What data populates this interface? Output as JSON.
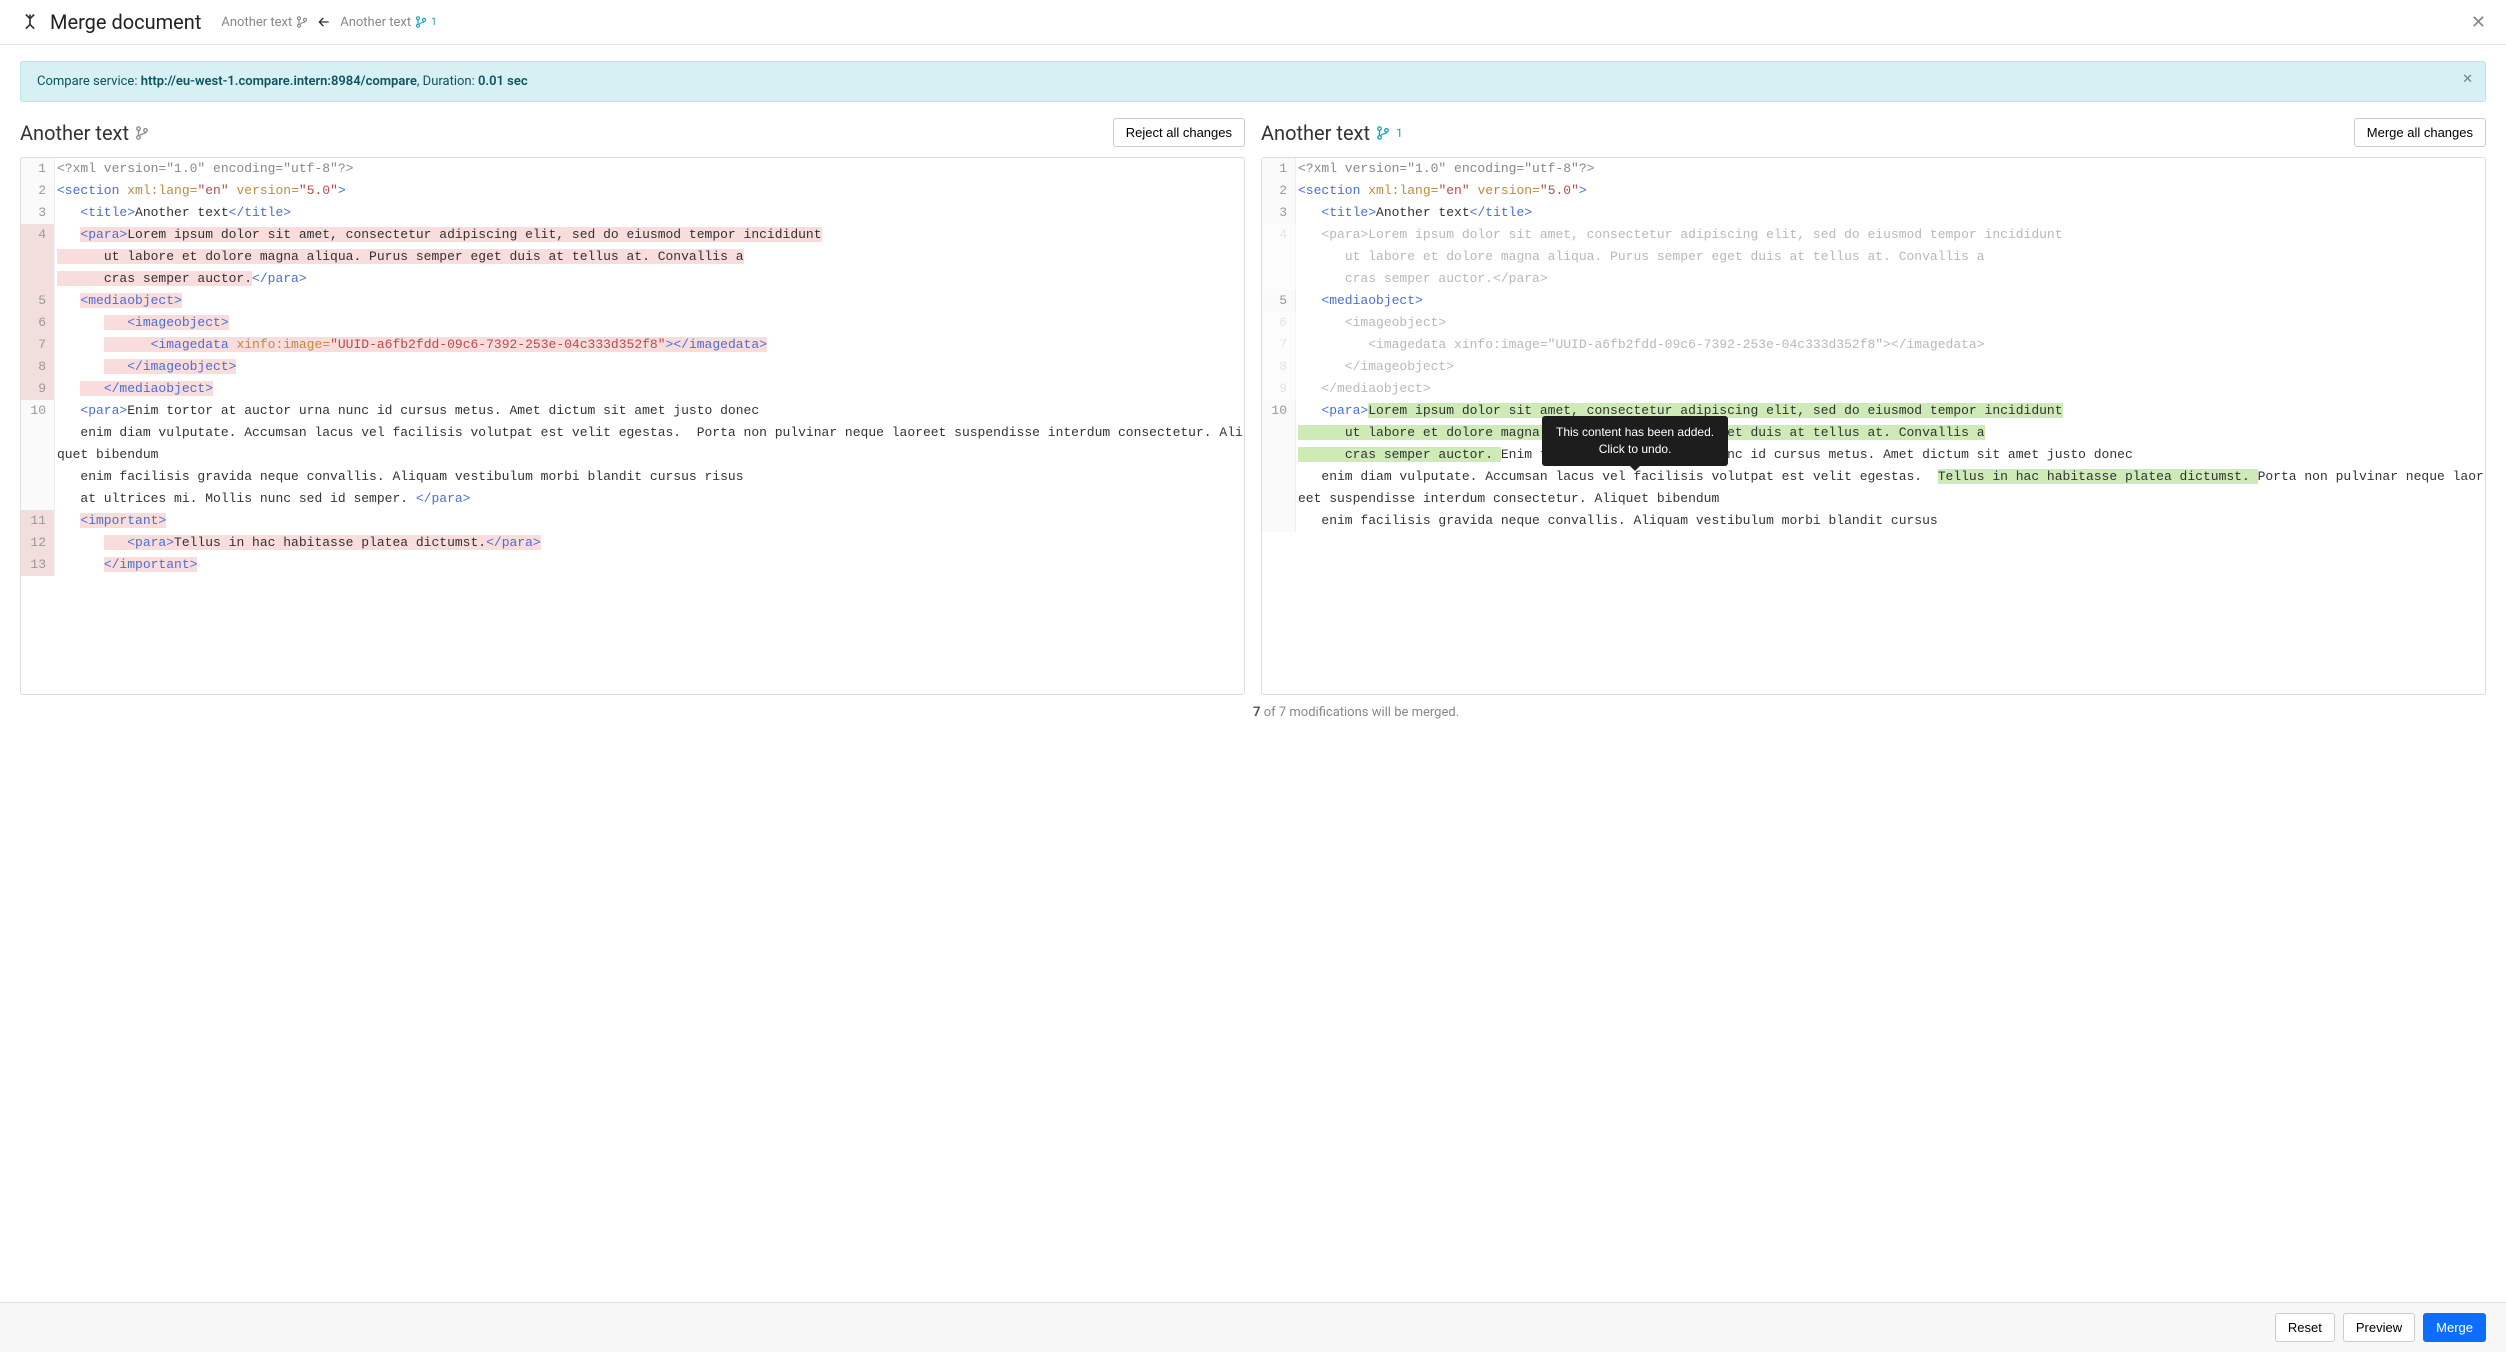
{
  "header": {
    "title": "Merge document",
    "breadcrumb_left": "Another text",
    "breadcrumb_right": "Another text",
    "branch_right_suffix": "1"
  },
  "banner": {
    "prefix": "Compare service: ",
    "url": "http://eu-west-1.compare.intern:8984/compare",
    "mid": ", Duration: ",
    "duration": "0.01 sec"
  },
  "left": {
    "title": "Another text",
    "button": "Reject all changes",
    "lines": [
      {
        "n": "1",
        "html": "<span class='pi'>&lt;?xml version=\"1.0\" encoding=\"utf-8\"?&gt;</span>"
      },
      {
        "n": "2",
        "html": "<span class='tag'>&lt;section</span> <span class='attr'>xml:lang=</span><span class='str'>\"en\"</span> <span class='attr'>version=</span><span class='str'>\"5.0\"</span><span class='tag'>&gt;</span>"
      },
      {
        "n": "3",
        "html": "   <span class='tag'>&lt;title&gt;</span>Another text<span class='tag'>&lt;/title&gt;</span>"
      },
      {
        "n": "4",
        "gut": "mod",
        "wrap": true,
        "html": "   <span class='del'><span class='tag'>&lt;para&gt;</span>Lorem ipsum dolor sit amet, consectetur adipiscing elit, sed do eiusmod tempor incididunt\n      ut labore et dolore magna aliqua. Purus semper eget duis at tellus at. Convallis a\n      cras semper auctor.</span><span class='tag'>&lt;/para&gt;</span>"
      },
      {
        "n": "5",
        "gut": "mod",
        "html": "   <span class='del'><span class='tag'>&lt;mediaobject&gt;</span></span>"
      },
      {
        "n": "6",
        "gut": "mod",
        "html": "      <span class='del'>   <span class='tag'>&lt;imageobject&gt;</span></span>"
      },
      {
        "n": "7",
        "gut": "mod",
        "wrap": true,
        "html": "      <span class='del'>      <span class='tag'>&lt;imagedata</span> <span class='attr'>xinfo:image=</span><span class='str'>\"UUID-a6fb2fdd-09c6-7392-253e-04c333d352f8\"</span><span class='tag'>&gt;&lt;/imagedata&gt;</span></span>"
      },
      {
        "n": "8",
        "gut": "mod",
        "html": "      <span class='del'>   <span class='tag'>&lt;/imageobject&gt;</span></span>"
      },
      {
        "n": "9",
        "gut": "mod",
        "html": "   <span class='del'>   <span class='tag'>&lt;/mediaobject&gt;</span></span>"
      },
      {
        "n": "10",
        "wrap": true,
        "html": "   <span class='tag'>&lt;para&gt;</span>Enim tortor at auctor urna nunc id cursus metus. Amet dictum sit amet justo donec\n   enim diam vulputate. Accumsan lacus vel facilisis volutpat est velit egestas.  Porta non pulvinar neque laoreet suspendisse interdum consectetur. Aliquet bibendum\n   enim facilisis gravida neque convallis. Aliquam vestibulum morbi blandit cursus risus\n   at ultrices mi. Mollis nunc sed id semper. <span class='tag'>&lt;/para&gt;</span>"
      },
      {
        "n": "11",
        "gut": "mod",
        "html": "   <span class='del'><span class='tag'>&lt;important&gt;</span></span>"
      },
      {
        "n": "12",
        "gut": "mod",
        "html": "      <span class='del'>   <span class='tag'>&lt;para&gt;</span>Tellus in hac habitasse platea dictumst.<span class='tag'>&lt;/para&gt;</span></span>"
      },
      {
        "n": "13",
        "gut": "mod",
        "html": "      <span class='del'><span class='tag'>&lt;/important&gt;</span></span>"
      }
    ]
  },
  "right": {
    "title": "Another text",
    "branch_suffix": "1",
    "button": "Merge all changes",
    "lines": [
      {
        "n": "1",
        "html": "<span class='pi'>&lt;?xml version=\"1.0\" encoding=\"utf-8\"?&gt;</span>"
      },
      {
        "n": "2",
        "html": "<span class='tag'>&lt;section</span> <span class='attr'>xml:lang=</span><span class='str'>\"en\"</span> <span class='attr'>version=</span><span class='str'>\"5.0\"</span><span class='tag'>&gt;</span>"
      },
      {
        "n": "3",
        "html": "   <span class='tag'>&lt;title&gt;</span>Another text<span class='tag'>&lt;/title&gt;</span>"
      },
      {
        "n": "4",
        "faded": true,
        "wrap": true,
        "html": "   &lt;para&gt;Lorem ipsum dolor sit amet, consectetur adipiscing elit, sed do eiusmod tempor incididunt\n      ut labore et dolore magna aliqua. Purus semper eget duis at tellus at. Convallis a\n      cras semper auctor.&lt;/para&gt;"
      },
      {
        "n": "5",
        "html": "   <span class='tag'>&lt;mediaobject&gt;</span>"
      },
      {
        "n": "6",
        "faded": true,
        "html": "      &lt;imageobject&gt;"
      },
      {
        "n": "7",
        "faded": true,
        "wrap": true,
        "html": "         &lt;imagedata xinfo:image=\"UUID-a6fb2fdd-09c6-7392-253e-04c333d352f8\"&gt;&lt;/imagedata&gt;"
      },
      {
        "n": "8",
        "faded": true,
        "html": "      &lt;/imageobject&gt;"
      },
      {
        "n": "9",
        "faded": true,
        "html": "   &lt;/mediaobject&gt;"
      },
      {
        "n": "10",
        "wrap": true,
        "html": "   <span class='tag'>&lt;para&gt;</span><span class='add'>Lorem ipsum dolor sit amet, consectetur adipiscing elit, sed do eiusmod tempor incididunt\n      ut labore et dolore magna aliqua. Purus semper eget duis at tellus at. Convallis a\n      cras semper auctor. </span>Enim tortor at auctor urna nunc id cursus metus. Amet dictum sit amet justo donec\n   enim diam vulputate. Accumsan lacus vel facilisis volutpat est velit egestas.  <span class='add'>Tellus in hac habitasse platea dictumst. </span>Porta non pulvinar neque laoreet suspendisse interdum consectetur. Aliquet bibendum\n   enim facilisis gravida neque convallis. Aliquam vestibulum morbi blandit cursus"
      }
    ]
  },
  "tooltip": {
    "line1": "This content has been added.",
    "line2": "Click to undo."
  },
  "status": {
    "count": "7",
    "rest": " of 7 modifications will be merged."
  },
  "actions": {
    "reset": "Reset",
    "preview": "Preview",
    "merge": "Merge"
  }
}
